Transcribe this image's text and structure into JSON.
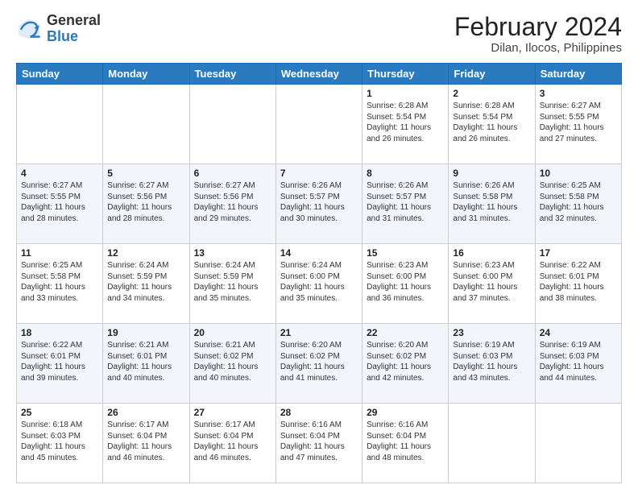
{
  "header": {
    "logo_general": "General",
    "logo_blue": "Blue",
    "month_year": "February 2024",
    "location": "Dilan, Ilocos, Philippines"
  },
  "days_of_week": [
    "Sunday",
    "Monday",
    "Tuesday",
    "Wednesday",
    "Thursday",
    "Friday",
    "Saturday"
  ],
  "weeks": [
    [
      {
        "num": "",
        "content": ""
      },
      {
        "num": "",
        "content": ""
      },
      {
        "num": "",
        "content": ""
      },
      {
        "num": "",
        "content": ""
      },
      {
        "num": "1",
        "content": "Sunrise: 6:28 AM\nSunset: 5:54 PM\nDaylight: 11 hours and 26 minutes."
      },
      {
        "num": "2",
        "content": "Sunrise: 6:28 AM\nSunset: 5:54 PM\nDaylight: 11 hours and 26 minutes."
      },
      {
        "num": "3",
        "content": "Sunrise: 6:27 AM\nSunset: 5:55 PM\nDaylight: 11 hours and 27 minutes."
      }
    ],
    [
      {
        "num": "4",
        "content": "Sunrise: 6:27 AM\nSunset: 5:55 PM\nDaylight: 11 hours and 28 minutes."
      },
      {
        "num": "5",
        "content": "Sunrise: 6:27 AM\nSunset: 5:56 PM\nDaylight: 11 hours and 28 minutes."
      },
      {
        "num": "6",
        "content": "Sunrise: 6:27 AM\nSunset: 5:56 PM\nDaylight: 11 hours and 29 minutes."
      },
      {
        "num": "7",
        "content": "Sunrise: 6:26 AM\nSunset: 5:57 PM\nDaylight: 11 hours and 30 minutes."
      },
      {
        "num": "8",
        "content": "Sunrise: 6:26 AM\nSunset: 5:57 PM\nDaylight: 11 hours and 31 minutes."
      },
      {
        "num": "9",
        "content": "Sunrise: 6:26 AM\nSunset: 5:58 PM\nDaylight: 11 hours and 31 minutes."
      },
      {
        "num": "10",
        "content": "Sunrise: 6:25 AM\nSunset: 5:58 PM\nDaylight: 11 hours and 32 minutes."
      }
    ],
    [
      {
        "num": "11",
        "content": "Sunrise: 6:25 AM\nSunset: 5:58 PM\nDaylight: 11 hours and 33 minutes."
      },
      {
        "num": "12",
        "content": "Sunrise: 6:24 AM\nSunset: 5:59 PM\nDaylight: 11 hours and 34 minutes."
      },
      {
        "num": "13",
        "content": "Sunrise: 6:24 AM\nSunset: 5:59 PM\nDaylight: 11 hours and 35 minutes."
      },
      {
        "num": "14",
        "content": "Sunrise: 6:24 AM\nSunset: 6:00 PM\nDaylight: 11 hours and 35 minutes."
      },
      {
        "num": "15",
        "content": "Sunrise: 6:23 AM\nSunset: 6:00 PM\nDaylight: 11 hours and 36 minutes."
      },
      {
        "num": "16",
        "content": "Sunrise: 6:23 AM\nSunset: 6:00 PM\nDaylight: 11 hours and 37 minutes."
      },
      {
        "num": "17",
        "content": "Sunrise: 6:22 AM\nSunset: 6:01 PM\nDaylight: 11 hours and 38 minutes."
      }
    ],
    [
      {
        "num": "18",
        "content": "Sunrise: 6:22 AM\nSunset: 6:01 PM\nDaylight: 11 hours and 39 minutes."
      },
      {
        "num": "19",
        "content": "Sunrise: 6:21 AM\nSunset: 6:01 PM\nDaylight: 11 hours and 40 minutes."
      },
      {
        "num": "20",
        "content": "Sunrise: 6:21 AM\nSunset: 6:02 PM\nDaylight: 11 hours and 40 minutes."
      },
      {
        "num": "21",
        "content": "Sunrise: 6:20 AM\nSunset: 6:02 PM\nDaylight: 11 hours and 41 minutes."
      },
      {
        "num": "22",
        "content": "Sunrise: 6:20 AM\nSunset: 6:02 PM\nDaylight: 11 hours and 42 minutes."
      },
      {
        "num": "23",
        "content": "Sunrise: 6:19 AM\nSunset: 6:03 PM\nDaylight: 11 hours and 43 minutes."
      },
      {
        "num": "24",
        "content": "Sunrise: 6:19 AM\nSunset: 6:03 PM\nDaylight: 11 hours and 44 minutes."
      }
    ],
    [
      {
        "num": "25",
        "content": "Sunrise: 6:18 AM\nSunset: 6:03 PM\nDaylight: 11 hours and 45 minutes."
      },
      {
        "num": "26",
        "content": "Sunrise: 6:17 AM\nSunset: 6:04 PM\nDaylight: 11 hours and 46 minutes."
      },
      {
        "num": "27",
        "content": "Sunrise: 6:17 AM\nSunset: 6:04 PM\nDaylight: 11 hours and 46 minutes."
      },
      {
        "num": "28",
        "content": "Sunrise: 6:16 AM\nSunset: 6:04 PM\nDaylight: 11 hours and 47 minutes."
      },
      {
        "num": "29",
        "content": "Sunrise: 6:16 AM\nSunset: 6:04 PM\nDaylight: 11 hours and 48 minutes."
      },
      {
        "num": "",
        "content": ""
      },
      {
        "num": "",
        "content": ""
      }
    ]
  ]
}
